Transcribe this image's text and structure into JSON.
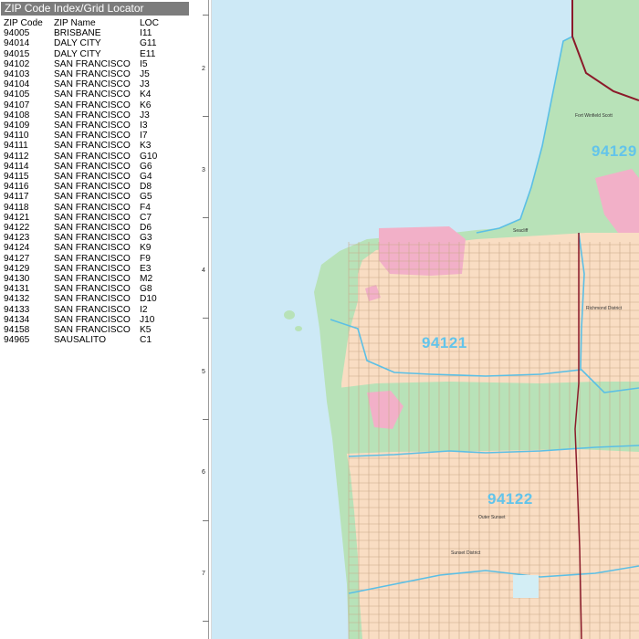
{
  "index": {
    "title": "ZIP Code Index/Grid Locator",
    "headers": {
      "zip": "ZIP Code",
      "name": "ZIP Name",
      "loc": "LOC"
    },
    "rows": [
      {
        "zip": "94005",
        "name": "BRISBANE",
        "loc": "I11"
      },
      {
        "zip": "94014",
        "name": "DALY CITY",
        "loc": "G11"
      },
      {
        "zip": "94015",
        "name": "DALY CITY",
        "loc": "E11"
      },
      {
        "zip": "94102",
        "name": "SAN FRANCISCO",
        "loc": "I5"
      },
      {
        "zip": "94103",
        "name": "SAN FRANCISCO",
        "loc": "J5"
      },
      {
        "zip": "94104",
        "name": "SAN FRANCISCO",
        "loc": "J3"
      },
      {
        "zip": "94105",
        "name": "SAN FRANCISCO",
        "loc": "K4"
      },
      {
        "zip": "94107",
        "name": "SAN FRANCISCO",
        "loc": "K6"
      },
      {
        "zip": "94108",
        "name": "SAN FRANCISCO",
        "loc": "J3"
      },
      {
        "zip": "94109",
        "name": "SAN FRANCISCO",
        "loc": "I3"
      },
      {
        "zip": "94110",
        "name": "SAN FRANCISCO",
        "loc": "I7"
      },
      {
        "zip": "94111",
        "name": "SAN FRANCISCO",
        "loc": "K3"
      },
      {
        "zip": "94112",
        "name": "SAN FRANCISCO",
        "loc": "G10"
      },
      {
        "zip": "94114",
        "name": "SAN FRANCISCO",
        "loc": "G6"
      },
      {
        "zip": "94115",
        "name": "SAN FRANCISCO",
        "loc": "G4"
      },
      {
        "zip": "94116",
        "name": "SAN FRANCISCO",
        "loc": "D8"
      },
      {
        "zip": "94117",
        "name": "SAN FRANCISCO",
        "loc": "G5"
      },
      {
        "zip": "94118",
        "name": "SAN FRANCISCO",
        "loc": "F4"
      },
      {
        "zip": "94121",
        "name": "SAN FRANCISCO",
        "loc": "C7"
      },
      {
        "zip": "94122",
        "name": "SAN FRANCISCO",
        "loc": "D6"
      },
      {
        "zip": "94123",
        "name": "SAN FRANCISCO",
        "loc": "G3"
      },
      {
        "zip": "94124",
        "name": "SAN FRANCISCO",
        "loc": "K9"
      },
      {
        "zip": "94127",
        "name": "SAN FRANCISCO",
        "loc": "F9"
      },
      {
        "zip": "94129",
        "name": "SAN FRANCISCO",
        "loc": "E3"
      },
      {
        "zip": "94130",
        "name": "SAN FRANCISCO",
        "loc": "M2"
      },
      {
        "zip": "94131",
        "name": "SAN FRANCISCO",
        "loc": "G8"
      },
      {
        "zip": "94132",
        "name": "SAN FRANCISCO",
        "loc": "D10"
      },
      {
        "zip": "94133",
        "name": "SAN FRANCISCO",
        "loc": "I2"
      },
      {
        "zip": "94134",
        "name": "SAN FRANCISCO",
        "loc": "J10"
      },
      {
        "zip": "94158",
        "name": "SAN FRANCISCO",
        "loc": "K5"
      },
      {
        "zip": "94965",
        "name": "SAUSALITO",
        "loc": "C1"
      }
    ]
  },
  "grid": {
    "rows": [
      "2",
      "3",
      "4",
      "5",
      "6",
      "7"
    ]
  },
  "map": {
    "zip_labels": [
      "94121",
      "94122",
      "94129"
    ],
    "place_labels": [
      "Fort Winfield Scott",
      "Seacliff",
      "Richmond District",
      "Outer Sunset",
      "Sunset District"
    ],
    "colors": {
      "water": "#cde9f6",
      "parkland": "#b8e2b8",
      "residential": "#f9ddc3",
      "golf": "#f2b0c8",
      "zip_boundary": "#5bbfe5",
      "highway": "#8b1a2a",
      "zip_label": "#63c4ea"
    }
  }
}
